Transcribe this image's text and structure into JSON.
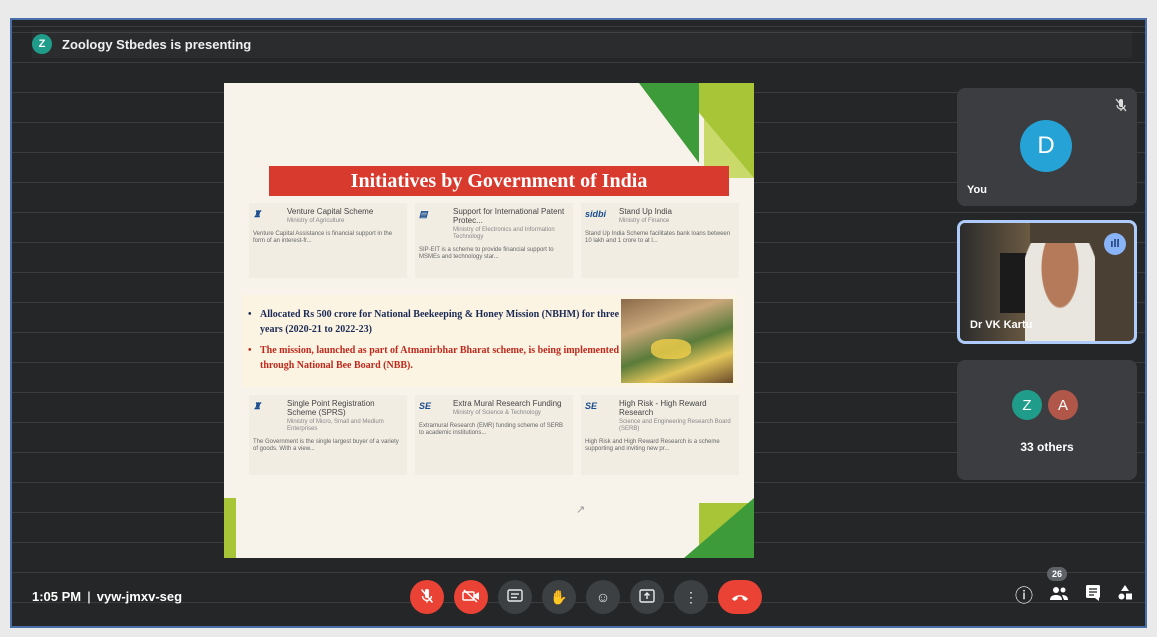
{
  "presenter": {
    "avatar_letter": "Z",
    "text": "Zoology Stbedes is presenting"
  },
  "slide": {
    "title": "Initiatives by Government of India",
    "schemes_top": [
      {
        "logo": "♜",
        "name": "Venture Capital Scheme",
        "sub": "Ministry of Agriculture",
        "desc": "Venture Capital Assistance is financial support in the form of an interest-fr..."
      },
      {
        "logo": "▤",
        "name": "Support for International Patent Protec...",
        "sub": "Ministry of Electronics and Information Technology",
        "desc": "SIP-EIT is a scheme to provide financial support to MSMEs and technology star..."
      },
      {
        "logo": "sidbi",
        "name": "Stand Up India",
        "sub": "Ministry of Finance",
        "desc": "Stand Up India Scheme facilitates bank loans between 10 lakh and 1 crore to at l..."
      }
    ],
    "bullet_1": "Allocated Rs 500 crore for National Beekeeping & Honey Mission (NBHM) for three years (2020-21 to 2022-23)",
    "bullet_2": "The mission, launched as part of Atmanirbhar Bharat scheme, is being implemented through National Bee Board (NBB).",
    "schemes_bottom": [
      {
        "logo": "♜",
        "name": "Single Point Registration Scheme (SPRS)",
        "sub": "Ministry of Micro, Small and Medium Enterprises",
        "desc": "The Government is the single largest buyer of a variety of goods. With a view..."
      },
      {
        "logo": "SE",
        "name": "Extra Mural Research Funding",
        "sub": "Ministry of Science & Technology",
        "desc": "Extramural Research (EMR) funding scheme of SERB to academic institutions..."
      },
      {
        "logo": "SE",
        "name": "High Risk - High Reward Research",
        "sub": "Science and Engineering Research Board (SERB)",
        "desc": "High Risk and High Reward Research is a scheme supporting and inviting new pr..."
      }
    ]
  },
  "tiles": {
    "you": {
      "avatar_letter": "D",
      "name": "You"
    },
    "speaker": {
      "name": "Dr VK Kartu"
    },
    "others": {
      "letters": [
        "Z",
        "A"
      ],
      "label": "33 others"
    }
  },
  "meeting": {
    "time": "1:05 PM",
    "separator": "|",
    "code": "vyw-jmxv-seg"
  },
  "people_count": "26",
  "icons": {
    "mic_off": "mic-off-icon",
    "camera_off": "camera-off-icon",
    "captions": "captions-icon",
    "hand": "raise-hand-icon",
    "emoji": "emoji-icon",
    "present": "present-screen-icon",
    "more": "more-options-icon",
    "hangup": "hang-up-icon",
    "info": "info-icon",
    "people": "people-icon",
    "chat": "chat-icon",
    "activities": "activities-icon"
  },
  "colors": {
    "background": "#242628",
    "control_button": "#3c4043",
    "danger": "#ea4335",
    "you_avatar": "#26a3d6",
    "slide_title": "#d93a2e",
    "speaking_border": "#aecbfa"
  }
}
